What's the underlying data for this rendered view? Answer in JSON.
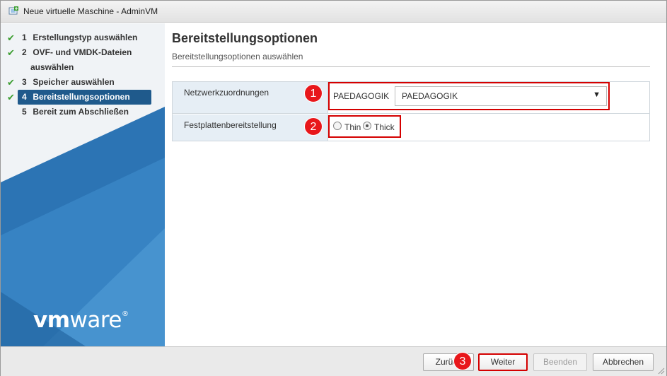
{
  "window": {
    "title": "Neue virtuelle Maschine - AdminVM"
  },
  "steps": [
    {
      "num": "1",
      "label": "Erstellungstyp auswählen",
      "done": true
    },
    {
      "num": "2",
      "label": "OVF- und VMDK-Dateien",
      "label_line2": "auswählen",
      "done": true
    },
    {
      "num": "3",
      "label": "Speicher auswählen",
      "done": true
    },
    {
      "num": "4",
      "label": "Bereitstellungsoptionen",
      "done": true,
      "active": true
    },
    {
      "num": "5",
      "label": "Bereit zum Abschließen",
      "done": false
    }
  ],
  "brand": {
    "vm": "vm",
    "ware": "ware",
    "reg": "®"
  },
  "main": {
    "heading": "Bereitstellungsoptionen",
    "subheading": "Bereitstellungsoptionen auswählen",
    "network": {
      "label": "Netzwerkzuordnungen",
      "source_network": "PAEDAGOGIK",
      "selected_network": "PAEDAGOGIK"
    },
    "disk": {
      "label": "Festplattenbereitstellung",
      "options": [
        "Thin",
        "Thick"
      ],
      "selected": "Thick"
    }
  },
  "annotations": [
    "1",
    "2",
    "3"
  ],
  "footer": {
    "back_label": "Zurück",
    "next_label": "Weiter",
    "finish_label": "Beenden",
    "cancel_label": "Abbrechen"
  },
  "colors": {
    "active_step": "#1f5a8c",
    "check": "#3a9d2f",
    "highlight_red": "#d40000",
    "badge_red": "#e8171b",
    "sidebar_blue": "#2e7fc2"
  }
}
